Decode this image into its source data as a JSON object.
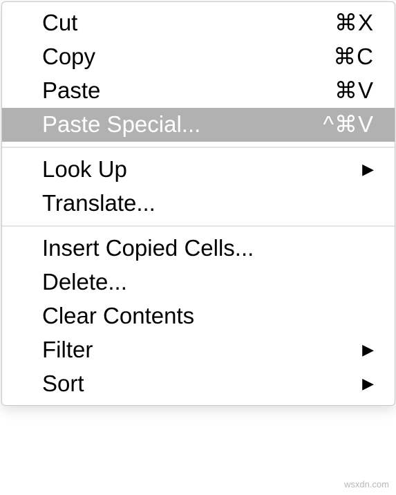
{
  "menu": {
    "groups": [
      [
        {
          "id": "cut",
          "label": "Cut",
          "shortcut": "⌘X",
          "submenu": false,
          "highlighted": false
        },
        {
          "id": "copy",
          "label": "Copy",
          "shortcut": "⌘C",
          "submenu": false,
          "highlighted": false
        },
        {
          "id": "paste",
          "label": "Paste",
          "shortcut": "⌘V",
          "submenu": false,
          "highlighted": false
        },
        {
          "id": "paste-special",
          "label": "Paste Special...",
          "shortcut": "^⌘V",
          "submenu": false,
          "highlighted": true
        }
      ],
      [
        {
          "id": "look-up",
          "label": "Look Up",
          "shortcut": "",
          "submenu": true,
          "highlighted": false
        },
        {
          "id": "translate",
          "label": "Translate...",
          "shortcut": "",
          "submenu": false,
          "highlighted": false
        }
      ],
      [
        {
          "id": "insert-copied-cells",
          "label": "Insert Copied Cells...",
          "shortcut": "",
          "submenu": false,
          "highlighted": false
        },
        {
          "id": "delete",
          "label": "Delete...",
          "shortcut": "",
          "submenu": false,
          "highlighted": false
        },
        {
          "id": "clear-contents",
          "label": "Clear Contents",
          "shortcut": "",
          "submenu": false,
          "highlighted": false
        },
        {
          "id": "filter",
          "label": "Filter",
          "shortcut": "",
          "submenu": true,
          "highlighted": false
        },
        {
          "id": "sort",
          "label": "Sort",
          "shortcut": "",
          "submenu": true,
          "highlighted": false
        }
      ]
    ]
  },
  "arrow_glyph": "▶",
  "watermark": "wsxdn.com"
}
